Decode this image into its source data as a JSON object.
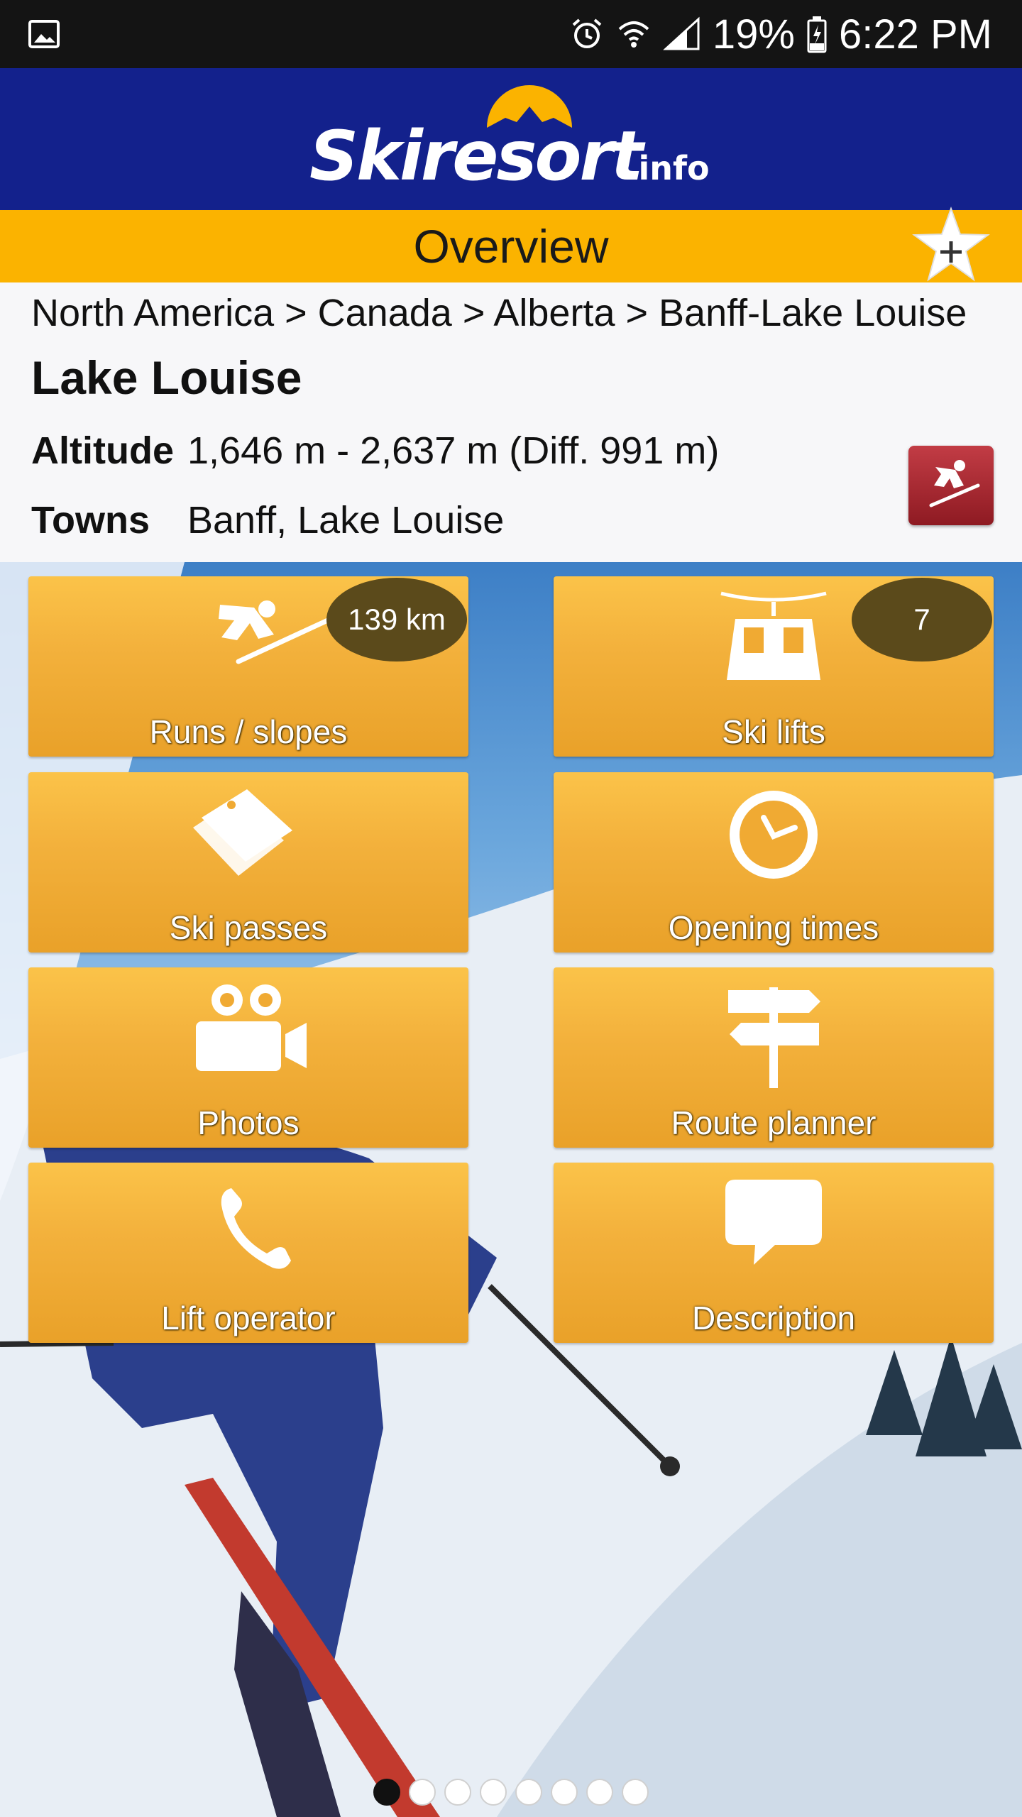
{
  "status_bar": {
    "battery": "19%",
    "time": "6:22 PM",
    "icons": [
      "image-icon",
      "alarm-icon",
      "wifi-icon",
      "signal-icon",
      "battery-icon"
    ]
  },
  "header": {
    "logo_main": "Skiresort",
    "logo_suffix": ".info"
  },
  "overview": {
    "title": "Overview"
  },
  "resort": {
    "breadcrumb": "North America > Canada > Alberta > Banff-Lake Louise",
    "name": "Lake Louise",
    "altitude_label": "Altitude",
    "altitude_value": "1,646 m - 2,637 m (Diff. 991 m)",
    "towns_label": "Towns",
    "towns_value": "Banff, Lake Louise"
  },
  "tiles": {
    "runs": {
      "label": "Runs / slopes",
      "badge": "139 km",
      "icon": "skier-icon"
    },
    "lifts": {
      "label": "Ski lifts",
      "badge": "7",
      "icon": "gondola-icon"
    },
    "passes": {
      "label": "Ski passes",
      "icon": "ticket-icon"
    },
    "opening": {
      "label": "Opening times",
      "icon": "clock-icon"
    },
    "photos": {
      "label": "Photos",
      "icon": "camera-icon"
    },
    "route": {
      "label": "Route planner",
      "icon": "signpost-icon"
    },
    "operator": {
      "label": "Lift operator",
      "icon": "phone-icon"
    },
    "description": {
      "label": "Description",
      "icon": "speech-bubble-icon"
    }
  },
  "pager": {
    "total_pages": 8,
    "current_page": 1
  },
  "colors": {
    "header_blue": "#13218c",
    "overview_yellow": "#fbb300",
    "tile_orange": "#f3b13c",
    "badge_brown": "#5b4a1b",
    "ski_badge_red": "#a82a33"
  }
}
